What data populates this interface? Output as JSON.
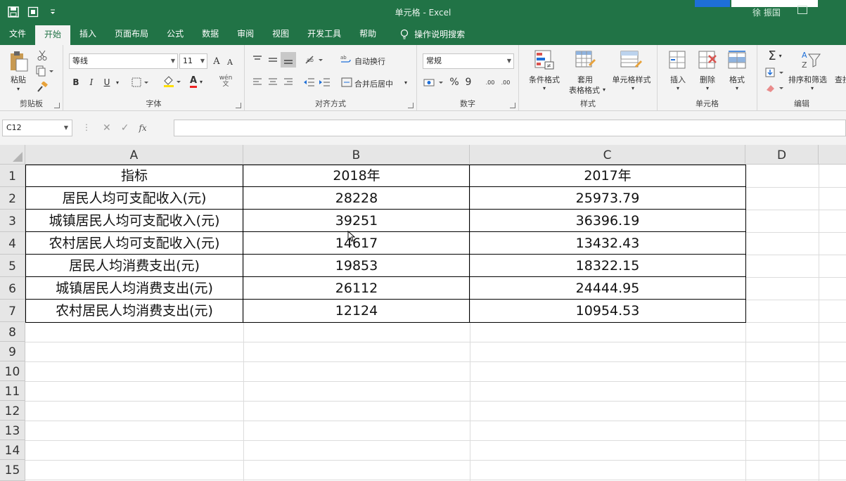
{
  "window": {
    "doc_title": "单元格  -  Excel",
    "user": "徐 振国"
  },
  "tabs": [
    "文件",
    "开始",
    "插入",
    "页面布局",
    "公式",
    "数据",
    "审阅",
    "视图",
    "开发工具",
    "帮助"
  ],
  "active_tab": "开始",
  "tell_me": "操作说明搜索",
  "ribbon": {
    "clipboard": {
      "paste": "粘贴",
      "group": "剪贴板"
    },
    "font": {
      "name": "等线",
      "size": "11",
      "grow": "A",
      "shrink": "A",
      "bold": "B",
      "italic": "I",
      "underline": "U",
      "font_color_letter": "A",
      "phonetic": "wén\n文",
      "group": "字体"
    },
    "alignment": {
      "wrap": "自动换行",
      "merge": "合并后居中",
      "group": "对齐方式"
    },
    "number": {
      "format": "常规",
      "percent": "%",
      "comma": "9",
      "inc_decimal": ".00",
      "dec_decimal": ".00",
      "group": "数字"
    },
    "styles": {
      "conditional": "条件格式",
      "table_1": "套用",
      "table_2": "表格格式",
      "cell_styles": "单元格样式",
      "group": "样式"
    },
    "cells": {
      "insert": "插入",
      "delete": "删除",
      "format": "格式",
      "group": "单元格"
    },
    "editing": {
      "sum": "Σ",
      "sort_filter": "排序和筛选",
      "find": "查找",
      "group": "编辑"
    }
  },
  "formula_bar": {
    "name_box": "C12",
    "cancel": "✕",
    "enter": "✓",
    "fx": "fx",
    "formula": ""
  },
  "sheet": {
    "columns": [
      "A",
      "B",
      "C",
      "D"
    ],
    "row_numbers": [
      "1",
      "2",
      "3",
      "4",
      "5",
      "6",
      "7",
      "8",
      "9",
      "10",
      "11",
      "12",
      "13",
      "14",
      "15"
    ],
    "rows": [
      [
        "指标",
        "2018年",
        "2017年"
      ],
      [
        "居民人均可支配收入(元)",
        "28228",
        "25973.79"
      ],
      [
        "城镇居民人均可支配收入(元)",
        "39251",
        "36396.19"
      ],
      [
        "农村居民人均可支配收入(元)",
        "14617",
        "13432.43"
      ],
      [
        "居民人均消费支出(元)",
        "19853",
        "18322.15"
      ],
      [
        "城镇居民人均消费支出(元)",
        "26112",
        "24444.95"
      ],
      [
        "农村居民人均消费支出(元)",
        "12124",
        "10954.53"
      ]
    ]
  }
}
